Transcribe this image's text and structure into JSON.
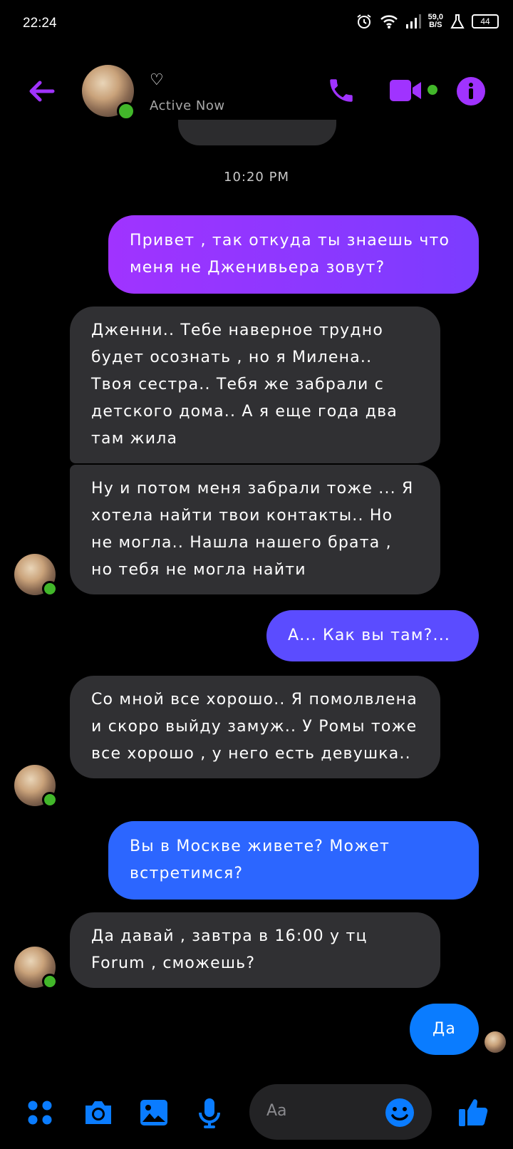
{
  "status_bar": {
    "time": "22:24",
    "net_speed_value": "59,0",
    "net_speed_unit": "B/S",
    "battery": "44"
  },
  "header": {
    "contact_name": "♡",
    "presence": "Active Now"
  },
  "timestamp": "10:20 PM",
  "messages": [
    {
      "from": "me",
      "text": "Привет , так откуда ты знаешь что меня не Дженивьера зовут?"
    },
    {
      "from": "them",
      "text": "Дженни.. Тебе наверное трудно будет осознать , но я Милена.. Твоя сестра.. Тебя же забрали с детского дома.. А я еще года два там жила"
    },
    {
      "from": "them",
      "text": "Ну и потом меня забрали тоже ... Я хотела найти твои контакты.. Но не могла.. Нашла нашего брата , но тебя не могла найти"
    },
    {
      "from": "me",
      "text": "А... Как вы там?..."
    },
    {
      "from": "them",
      "text": "Со мной все хорошо.. Я помолвлена и скоро выйду замуж.. У Ромы тоже все хорошо , у него есть девушка.."
    },
    {
      "from": "me",
      "text": "Вы в Москве живете? Может встретимся?"
    },
    {
      "from": "them",
      "text": "Да давай , завтра в 16:00 у тц Forum , сможешь?"
    },
    {
      "from": "me",
      "text": "Да"
    }
  ],
  "composer": {
    "placeholder": "Aa"
  },
  "colors": {
    "accent_purple": "#a033ff",
    "bubble_gray": "#303033",
    "messenger_blue": "#0a7cff",
    "online_green": "#42b72a"
  },
  "icons": [
    "back-arrow-icon",
    "phone-icon",
    "video-camera-icon",
    "info-icon",
    "menu-dots-icon",
    "camera-icon",
    "gallery-icon",
    "microphone-icon",
    "emoji-icon",
    "thumbs-up-icon"
  ]
}
